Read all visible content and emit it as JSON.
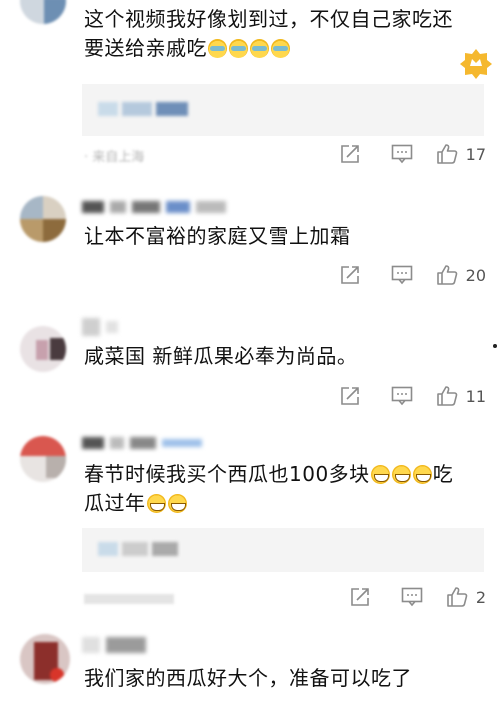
{
  "comments": [
    {
      "text": "这个视频我好像划到过，不仅自己家吃还要送给亲戚吃",
      "emojis": [
        "cry",
        "cry",
        "cry",
        "cry"
      ],
      "reply_meta": "· 来自上海",
      "likes": "17"
    },
    {
      "text": "让本不富裕的家庭又雪上加霜",
      "likes": "20"
    },
    {
      "text": "咸菜国 新鲜瓜果必奉为尚品。",
      "likes": "11"
    },
    {
      "text_part1": "春节时候我买个西瓜也100多块",
      "text_part2": "吃瓜过年",
      "emojis_mid": [
        "grin",
        "grin",
        "grin"
      ],
      "emojis_end": [
        "grin",
        "grin"
      ],
      "likes": "2"
    },
    {
      "text": "我们家的西瓜好大个，准备可以吃了"
    }
  ],
  "icons": {
    "share": "share-icon",
    "reply": "comment-icon",
    "like": "thumb-up-icon",
    "badge": "membership-badge-icon"
  },
  "colors": {
    "reply_bg": "#f4f4f4",
    "icon_gray": "#8c8c8c",
    "badge_gold": "#f5b82e"
  }
}
